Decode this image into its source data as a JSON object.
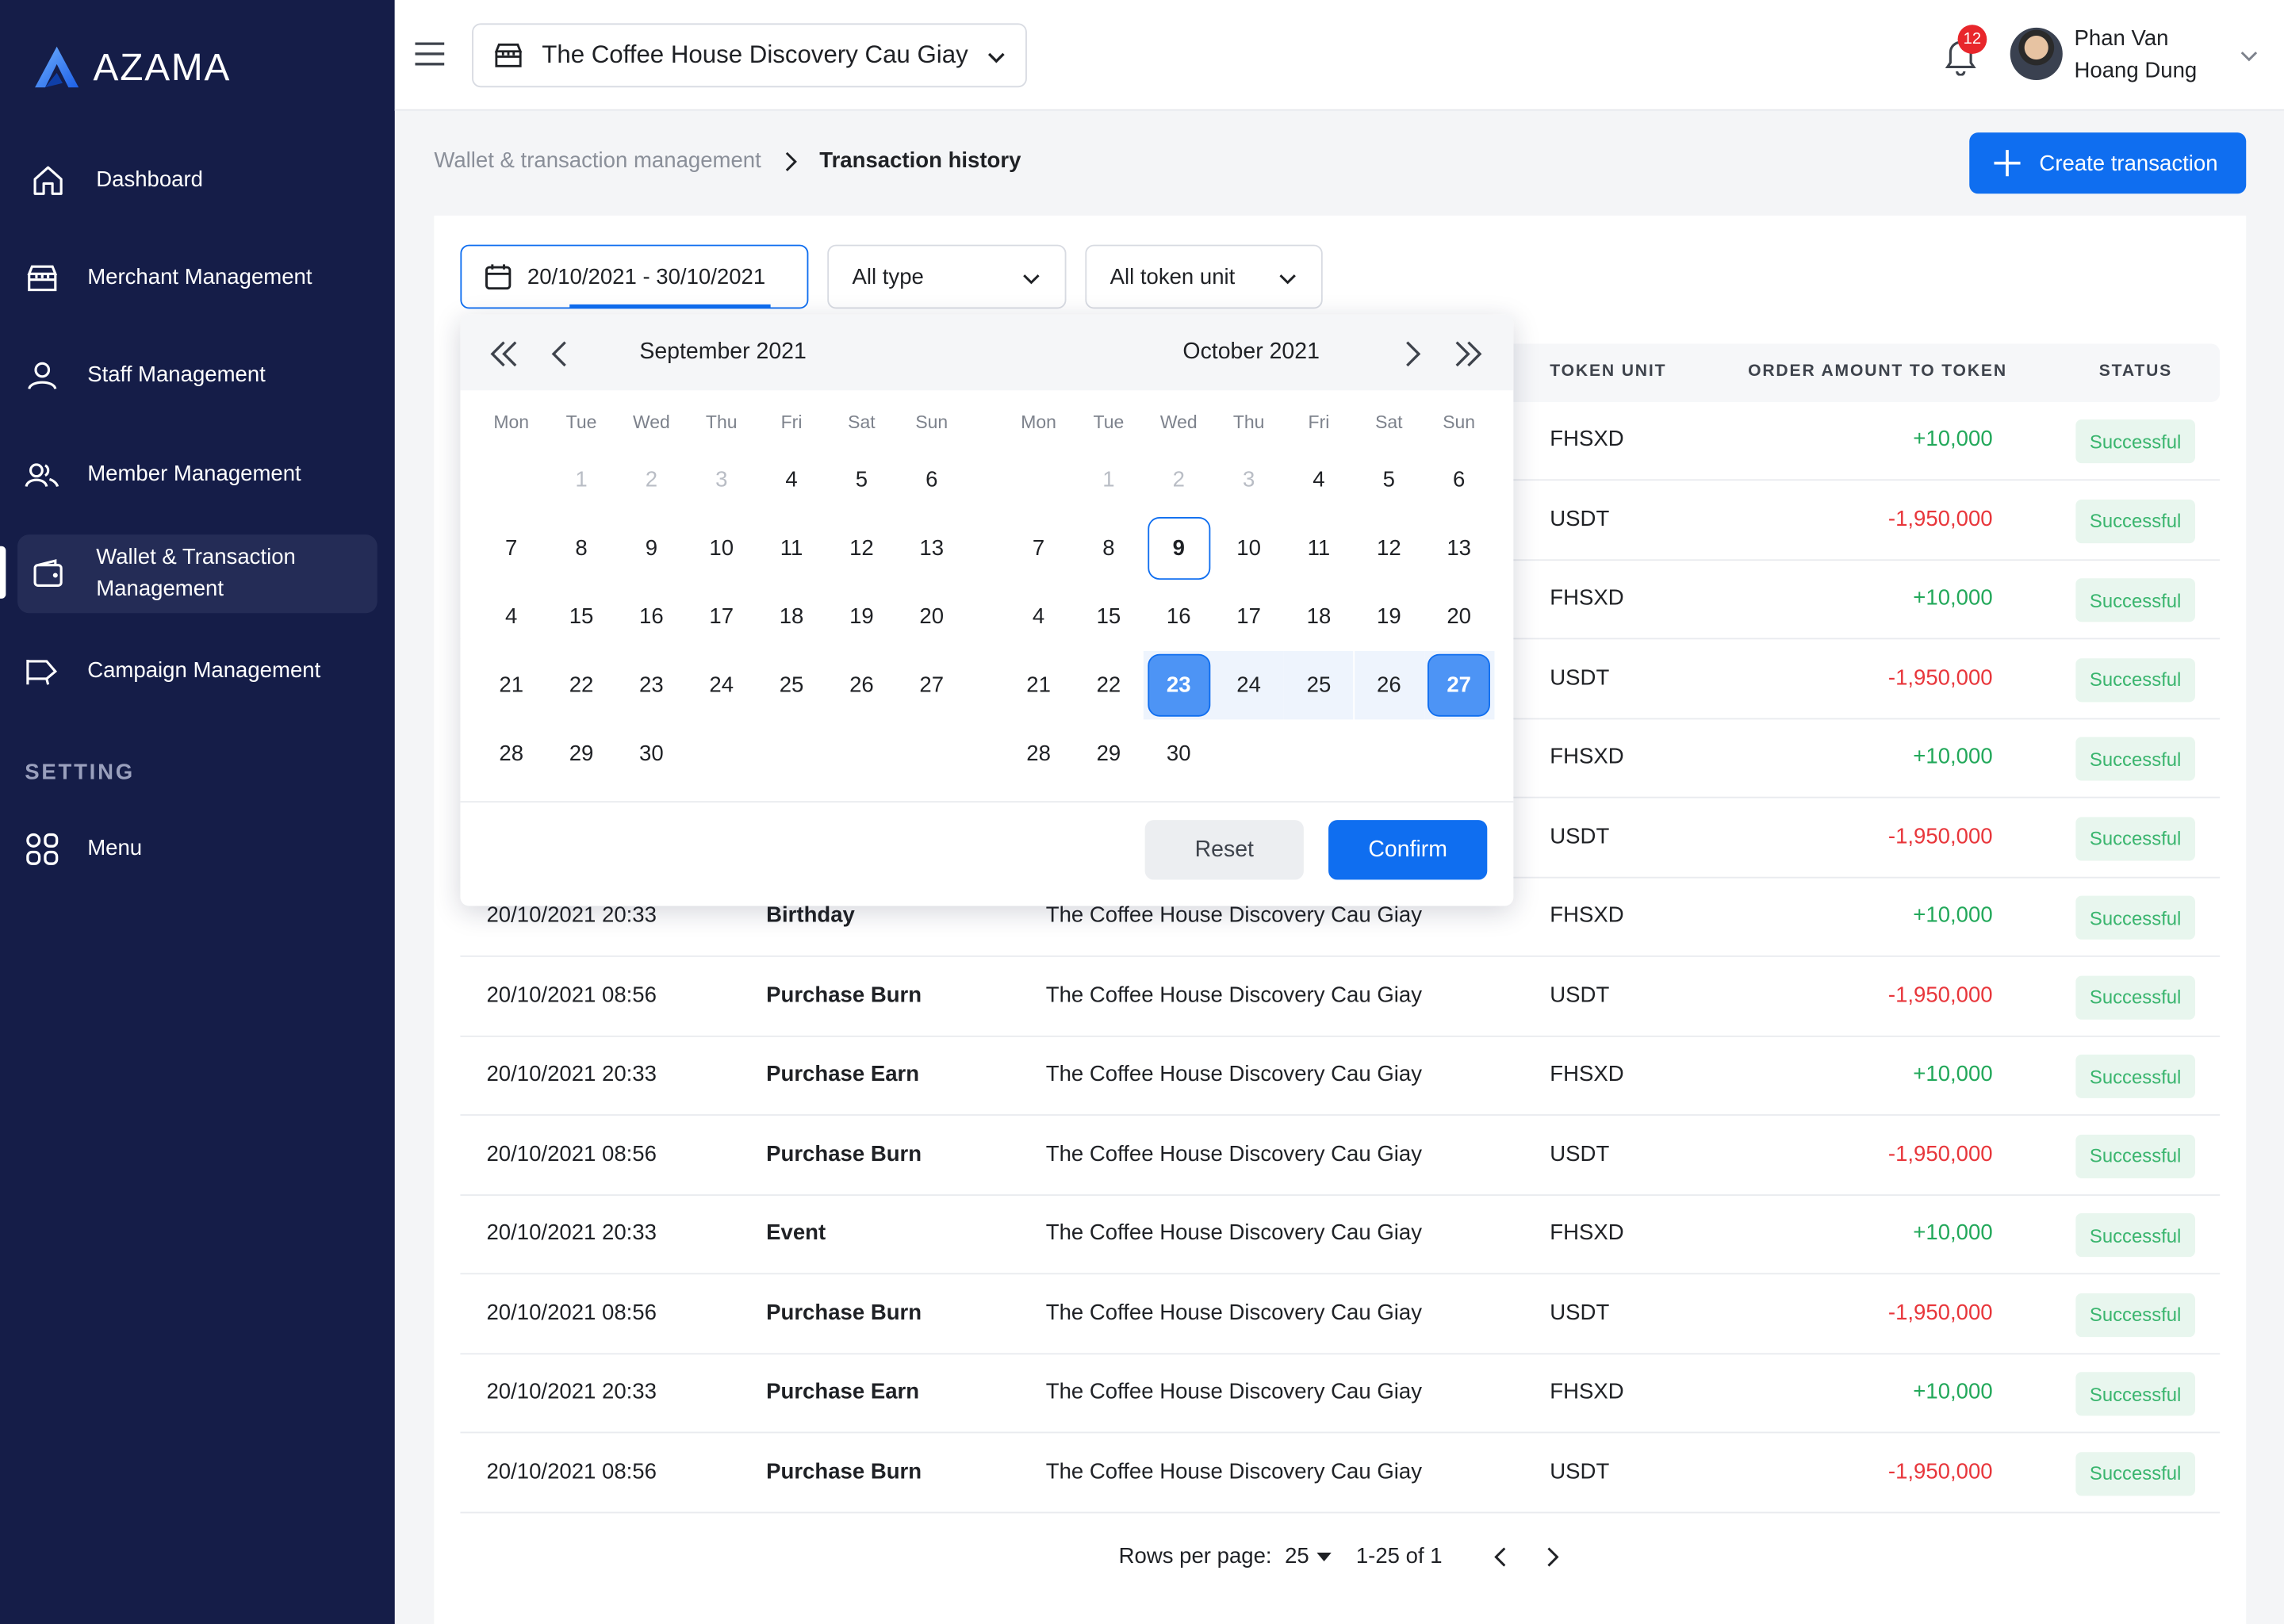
{
  "brand": {
    "name": "AZAMA"
  },
  "sidebar": {
    "items": [
      {
        "label": "Dashboard",
        "icon": "home-icon"
      },
      {
        "label": "Merchant Management",
        "icon": "store-icon"
      },
      {
        "label": "Staff Management",
        "icon": "user-icon"
      },
      {
        "label": "Member Management",
        "icon": "users-icon"
      },
      {
        "label": "Wallet & Transaction Management",
        "icon": "wallet-icon",
        "active": true
      },
      {
        "label": "Campaign Management",
        "icon": "megaphone-icon"
      }
    ],
    "section_label": "SETTING",
    "setting_items": [
      {
        "label": "Menu",
        "icon": "grid-icon"
      }
    ]
  },
  "header": {
    "store": "The Coffee House Discovery Cau Giay",
    "notifications": "12",
    "user_first": "Phan Van",
    "user_last": "Hoang Dung"
  },
  "breadcrumb": {
    "parent": "Wallet & transaction management",
    "current": "Transaction history"
  },
  "create_button": "Create transaction",
  "filters": {
    "date_range": "20/10/2021 - 30/10/2021",
    "type": "All type",
    "token": "All token unit"
  },
  "table": {
    "headers": {
      "token": "TOKEN UNIT",
      "amount": "ORDER AMOUNT TO TOKEN",
      "status": "STATUS"
    },
    "rows": [
      {
        "time": "",
        "type": "",
        "store": "",
        "token": "FHSXD",
        "amount": "+10,000",
        "status": "Successful"
      },
      {
        "time": "",
        "type": "",
        "store": "",
        "token": "USDT",
        "amount": "-1,950,000",
        "status": "Successful"
      },
      {
        "time": "",
        "type": "",
        "store": "",
        "token": "FHSXD",
        "amount": "+10,000",
        "status": "Successful"
      },
      {
        "time": "",
        "type": "",
        "store": "",
        "token": "USDT",
        "amount": "-1,950,000",
        "status": "Successful"
      },
      {
        "time": "",
        "type": "",
        "store": "",
        "token": "FHSXD",
        "amount": "+10,000",
        "status": "Successful"
      },
      {
        "time": "",
        "type": "",
        "store": "",
        "token": "USDT",
        "amount": "-1,950,000",
        "status": "Successful"
      },
      {
        "time": "20/10/2021 20:33",
        "type": "Birthday",
        "store": "The Coffee House Discovery Cau Giay",
        "token": "FHSXD",
        "amount": "+10,000",
        "status": "Successful"
      },
      {
        "time": "20/10/2021 08:56",
        "type": "Purchase Burn",
        "store": "The Coffee House Discovery Cau Giay",
        "token": "USDT",
        "amount": "-1,950,000",
        "status": "Successful"
      },
      {
        "time": "20/10/2021 20:33",
        "type": "Purchase Earn",
        "store": "The Coffee House Discovery Cau Giay",
        "token": "FHSXD",
        "amount": "+10,000",
        "status": "Successful"
      },
      {
        "time": "20/10/2021 08:56",
        "type": "Purchase Burn",
        "store": "The Coffee House Discovery Cau Giay",
        "token": "USDT",
        "amount": "-1,950,000",
        "status": "Successful"
      },
      {
        "time": "20/10/2021 20:33",
        "type": "Event",
        "store": "The Coffee House Discovery Cau Giay",
        "token": "FHSXD",
        "amount": "+10,000",
        "status": "Successful"
      },
      {
        "time": "20/10/2021 08:56",
        "type": "Purchase Burn",
        "store": "The Coffee House Discovery Cau Giay",
        "token": "USDT",
        "amount": "-1,950,000",
        "status": "Successful"
      },
      {
        "time": "20/10/2021 20:33",
        "type": "Purchase Earn",
        "store": "The Coffee House Discovery Cau Giay",
        "token": "FHSXD",
        "amount": "+10,000",
        "status": "Successful"
      },
      {
        "time": "20/10/2021 08:56",
        "type": "Purchase Burn",
        "store": "The Coffee House Discovery Cau Giay",
        "token": "USDT",
        "amount": "-1,950,000",
        "status": "Successful"
      }
    ]
  },
  "pagination": {
    "rows_label": "Rows per page:",
    "rows_value": "25",
    "range": "1-25 of 1"
  },
  "picker": {
    "left_month": "September 2021",
    "right_month": "October 2021",
    "weekdays": [
      "Mon",
      "Tue",
      "Wed",
      "Thu",
      "Fri",
      "Sat",
      "Sun"
    ],
    "left_days": [
      [
        null,
        "1",
        "2",
        "3",
        "4",
        "5",
        "6"
      ],
      [
        "7",
        "8",
        "9",
        "10",
        "11",
        "12",
        "13"
      ],
      [
        "4",
        "15",
        "16",
        "17",
        "18",
        "19",
        "20"
      ],
      [
        "21",
        "22",
        "23",
        "24",
        "25",
        "26",
        "27"
      ],
      [
        "28",
        "29",
        "30",
        null,
        null,
        null,
        null
      ]
    ],
    "right_days": [
      [
        null,
        "1",
        "2",
        "3",
        "4",
        "5",
        "6"
      ],
      [
        "7",
        "8",
        "9",
        "10",
        "11",
        "12",
        "13"
      ],
      [
        "4",
        "15",
        "16",
        "17",
        "18",
        "19",
        "20"
      ],
      [
        "21",
        "22",
        "23",
        "24",
        "25",
        "26",
        "27"
      ],
      [
        "28",
        "29",
        "30",
        null,
        null,
        null,
        null
      ]
    ],
    "muted_days": [
      "1",
      "2",
      "3"
    ],
    "today": "9",
    "range_start": "23",
    "range_end": "27",
    "reset": "Reset",
    "confirm": "Confirm"
  },
  "colors": {
    "sidebar": "#151d48",
    "accent": "#0f6ef0",
    "positive": "#22a85a",
    "negative": "#e8363b",
    "status_bg": "#e8f6ee"
  }
}
